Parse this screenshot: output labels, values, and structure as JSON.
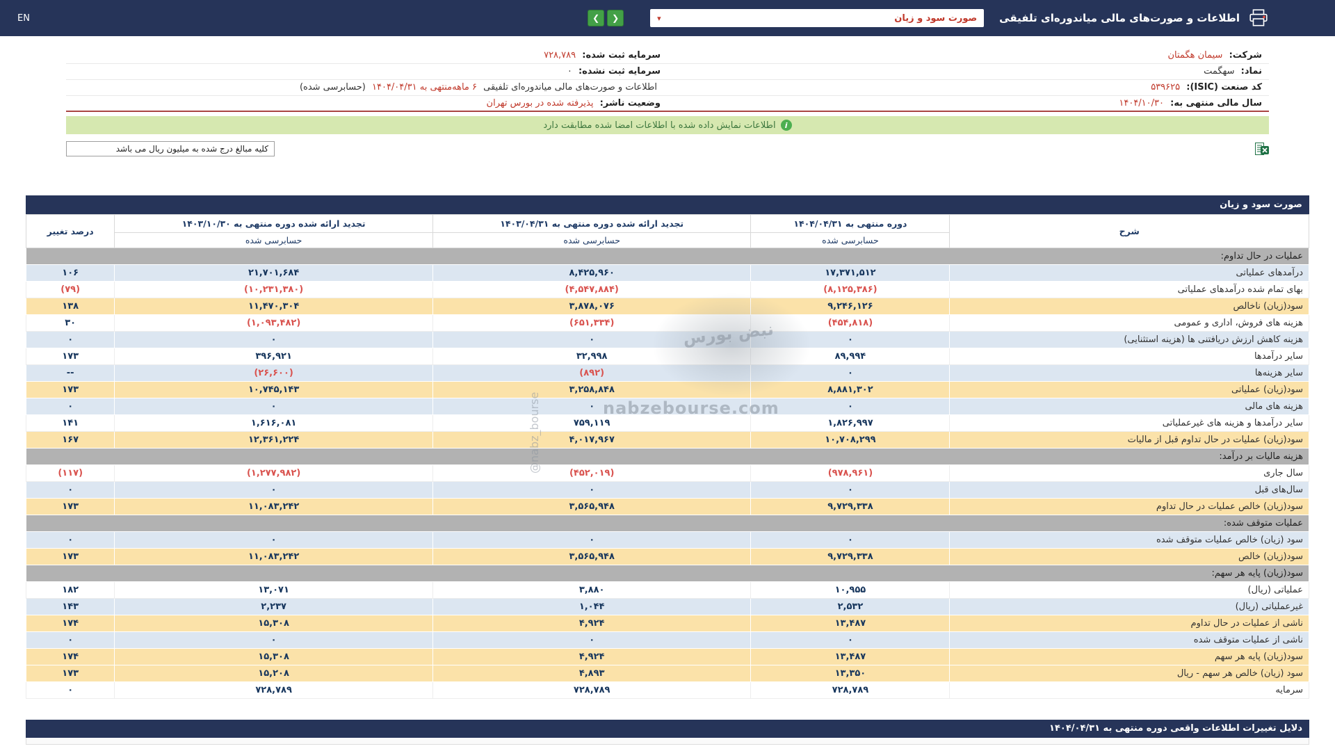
{
  "top_bar": {
    "title": "اطلاعات و صورت‌های مالی میاندوره‌ای تلفیقی",
    "selected_report": "صورت سود و زیان",
    "dropdown_caret": "▾",
    "prev_arrow": "❮",
    "next_arrow": "❯",
    "lang_label": "EN"
  },
  "company": {
    "rows": [
      {
        "r_label": "شرکت:",
        "r_value": "سیمان هگمتان",
        "l_label": "سرمایه ثبت شده:",
        "l_value": "۷۲۸,۷۸۹"
      },
      {
        "r_label": "نماد:",
        "r_value": "سهگمت",
        "l_label": "سرمایه ثبت نشده:",
        "l_value": "۰"
      },
      {
        "r_label": "کد صنعت (ISIC):",
        "r_value": "۵۳۹۶۲۵",
        "l_prefix": "اطلاعات و صورت‌های مالی میاندوره‌ای تلفیقی ",
        "l_highlight": "۶ ماهه‌منتهی به ۱۴۰۴/۰۴/۳۱",
        "l_suffix": "(حسابرسی شده)"
      },
      {
        "r_label": "سال مالی منتهی به:",
        "r_value": "۱۴۰۴/۱۰/۳۰",
        "l_label": "وضعیت ناشر:",
        "l_value": "پذیرفته شده در بورس تهران"
      }
    ]
  },
  "notice": {
    "icon_glyph": "i",
    "text": "اطلاعات نمایش داده شده با اطلاعات امضا شده مطابقت دارد"
  },
  "unit_note": "کلیه مبالغ درج شده به میلیون ریال می باشد",
  "statement": {
    "title": "صورت سود و زیان",
    "col_desc": "شرح",
    "col_change": "درصد تغییر",
    "cols": [
      {
        "period": "دوره منتهی به ۱۴۰۴/۰۴/۳۱",
        "audit": "حسابرسی شده"
      },
      {
        "period": "تجدید ارائه شده دوره منتهی به ۱۴۰۳/۰۴/۳۱",
        "audit": "حسابرسی شده"
      },
      {
        "period": "تجدید ارائه شده دوره منتهی به ۱۴۰۳/۱۰/۳۰",
        "audit": "حسابرسی شده"
      }
    ],
    "rows": [
      {
        "type": "section",
        "label": "عملیات در حال تداوم:"
      },
      {
        "type": "data",
        "bg": "blue",
        "label": "درآمدهای عملیاتی",
        "values": [
          "۱۷,۳۷۱,۵۱۲",
          "۸,۴۲۵,۹۶۰",
          "۲۱,۷۰۱,۶۸۴"
        ],
        "change": "۱۰۶"
      },
      {
        "type": "data",
        "bg": "white",
        "label": "بهای تمام شده درآمدهای عملیاتی",
        "values": [
          "(۸,۱۲۵,۳۸۶)",
          "(۴,۵۴۷,۸۸۴)",
          "(۱۰,۲۳۱,۳۸۰)"
        ],
        "change": "(۷۹)"
      },
      {
        "type": "data",
        "bg": "yellow",
        "label": "سود(زیان) ناخالص",
        "values": [
          "۹,۲۴۶,۱۲۶",
          "۳,۸۷۸,۰۷۶",
          "۱۱,۴۷۰,۳۰۴"
        ],
        "change": "۱۳۸"
      },
      {
        "type": "data",
        "bg": "white",
        "label": "هزینه های فروش، اداری و عمومی",
        "values": [
          "(۴۵۴,۸۱۸)",
          "(۶۵۱,۳۳۴)",
          "(۱,۰۹۳,۴۸۲)"
        ],
        "change": "۳۰"
      },
      {
        "type": "data",
        "bg": "blue",
        "label": "هزینه کاهش ارزش دریافتنی ها (هزینه استثنایی)",
        "values": [
          "۰",
          "۰",
          "۰"
        ],
        "change": "۰"
      },
      {
        "type": "data",
        "bg": "white",
        "label": "سایر درآمدها",
        "values": [
          "۸۹,۹۹۴",
          "۳۲,۹۹۸",
          "۳۹۶,۹۲۱"
        ],
        "change": "۱۷۳"
      },
      {
        "type": "data",
        "bg": "blue",
        "label": "سایر هزینه‌ها",
        "values": [
          "۰",
          "(۸۹۲)",
          "(۲۶,۶۰۰)"
        ],
        "change": "--"
      },
      {
        "type": "data",
        "bg": "yellow",
        "label": "سود(زیان) عملیاتی",
        "values": [
          "۸,۸۸۱,۳۰۲",
          "۳,۲۵۸,۸۴۸",
          "۱۰,۷۴۵,۱۴۳"
        ],
        "change": "۱۷۳"
      },
      {
        "type": "data",
        "bg": "blue",
        "label": "هزینه های مالی",
        "values": [
          "۰",
          "۰",
          "۰"
        ],
        "change": "۰"
      },
      {
        "type": "data",
        "bg": "white",
        "label": "سایر درآمدها و هزینه های غیرعملیاتی",
        "values": [
          "۱,۸۲۶,۹۹۷",
          "۷۵۹,۱۱۹",
          "۱,۶۱۶,۰۸۱"
        ],
        "change": "۱۴۱"
      },
      {
        "type": "data",
        "bg": "yellow",
        "label": "سود(زیان) عملیات در حال تداوم قبل از مالیات",
        "values": [
          "۱۰,۷۰۸,۲۹۹",
          "۴,۰۱۷,۹۶۷",
          "۱۲,۳۶۱,۲۲۴"
        ],
        "change": "۱۶۷"
      },
      {
        "type": "section",
        "label": "هزینه مالیات بر درآمد:"
      },
      {
        "type": "data",
        "bg": "white",
        "label": "سال جاری",
        "values": [
          "(۹۷۸,۹۶۱)",
          "(۴۵۲,۰۱۹)",
          "(۱,۲۷۷,۹۸۲)"
        ],
        "change": "(۱۱۷)"
      },
      {
        "type": "data",
        "bg": "blue",
        "label": "سال‌های قبل",
        "values": [
          "۰",
          "۰",
          "۰"
        ],
        "change": "۰"
      },
      {
        "type": "data",
        "bg": "yellow",
        "label": "سود(زیان) خالص عملیات در حال تداوم",
        "values": [
          "۹,۷۲۹,۳۳۸",
          "۳,۵۶۵,۹۴۸",
          "۱۱,۰۸۳,۲۴۲"
        ],
        "change": "۱۷۳"
      },
      {
        "type": "section",
        "label": "عملیات متوقف شده:"
      },
      {
        "type": "data",
        "bg": "blue",
        "label": "سود (زیان) خالص عملیات متوقف شده",
        "values": [
          "۰",
          "۰",
          "۰"
        ],
        "change": "۰"
      },
      {
        "type": "data",
        "bg": "yellow",
        "label": "سود(زیان) خالص",
        "values": [
          "۹,۷۲۹,۳۳۸",
          "۳,۵۶۵,۹۴۸",
          "۱۱,۰۸۳,۲۴۲"
        ],
        "change": "۱۷۳"
      },
      {
        "type": "section",
        "label": "سود(زیان) پایه هر سهم:"
      },
      {
        "type": "data",
        "bg": "white",
        "label": "عملیاتی (ریال)",
        "values": [
          "۱۰,۹۵۵",
          "۳,۸۸۰",
          "۱۳,۰۷۱"
        ],
        "change": "۱۸۲"
      },
      {
        "type": "data",
        "bg": "blue",
        "label": "غیرعملیاتی (ریال)",
        "values": [
          "۲,۵۳۲",
          "۱,۰۴۴",
          "۲,۲۳۷"
        ],
        "change": "۱۴۳"
      },
      {
        "type": "data",
        "bg": "yellow",
        "label": "ناشی از عملیات در حال تداوم",
        "values": [
          "۱۳,۴۸۷",
          "۴,۹۲۴",
          "۱۵,۳۰۸"
        ],
        "change": "۱۷۴"
      },
      {
        "type": "data",
        "bg": "blue",
        "label": "ناشی از عملیات متوقف شده",
        "values": [
          "۰",
          "۰",
          "۰"
        ],
        "change": "۰"
      },
      {
        "type": "data",
        "bg": "yellow",
        "label": "سود(زیان) پایه هر سهم",
        "values": [
          "۱۳,۴۸۷",
          "۴,۹۲۴",
          "۱۵,۳۰۸"
        ],
        "change": "۱۷۴"
      },
      {
        "type": "data",
        "bg": "yellow",
        "label": "سود (زیان) خالص هر سهم - ریال",
        "values": [
          "۱۳,۳۵۰",
          "۴,۸۹۳",
          "۱۵,۲۰۸"
        ],
        "change": "۱۷۳"
      },
      {
        "type": "data",
        "bg": "white",
        "label": "سرمایه",
        "values": [
          "۷۲۸,۷۸۹",
          "۷۲۸,۷۸۹",
          "۷۲۸,۷۸۹"
        ],
        "change": "۰"
      }
    ]
  },
  "footer": {
    "title": "دلایل تغییرات اطلاعات واقعی دوره منتهی به ۱۴۰۴/۰۴/۳۱"
  },
  "watermark": {
    "fa": "نبض بورس",
    "site": "nabzebourse.com",
    "handle": "@nabz_bourse"
  }
}
